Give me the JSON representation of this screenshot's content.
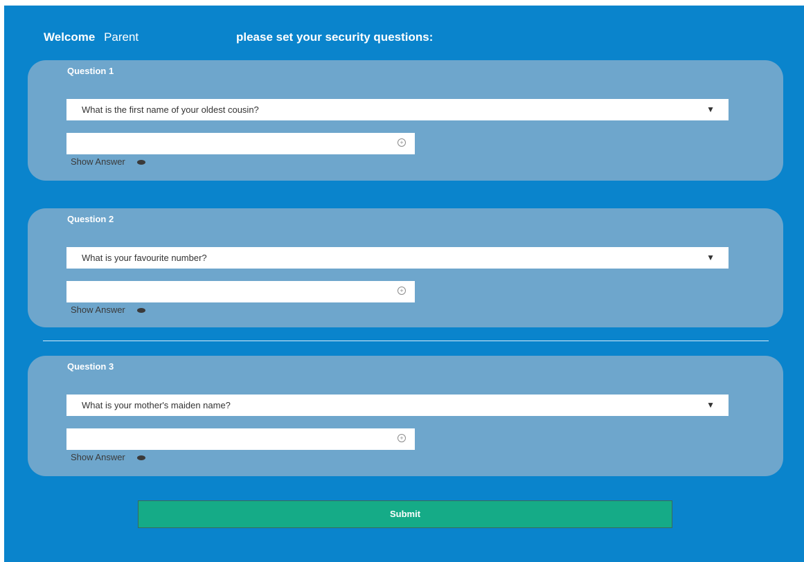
{
  "header": {
    "welcome": "Welcome",
    "user_name": "Parent",
    "prompt": "please set your security questions:"
  },
  "questions": [
    {
      "title": "Question 1",
      "selected": "What is the first name of your oldest cousin?",
      "answer_value": "",
      "show_answer_label": "Show Answer"
    },
    {
      "title": "Question 2",
      "selected": "What is your favourite number?",
      "answer_value": "",
      "show_answer_label": "Show Answer"
    },
    {
      "title": "Question 3",
      "selected": "What is your mother's maiden name?",
      "answer_value": "",
      "show_answer_label": "Show Answer"
    }
  ],
  "icons": {
    "dropdown": "caret-down-icon",
    "key": "key-icon",
    "eye": "eye-icon"
  },
  "submit_label": "Submit",
  "colors": {
    "background": "#0a84cc",
    "card": "#6ea6cc",
    "submit": "#15ab87"
  }
}
